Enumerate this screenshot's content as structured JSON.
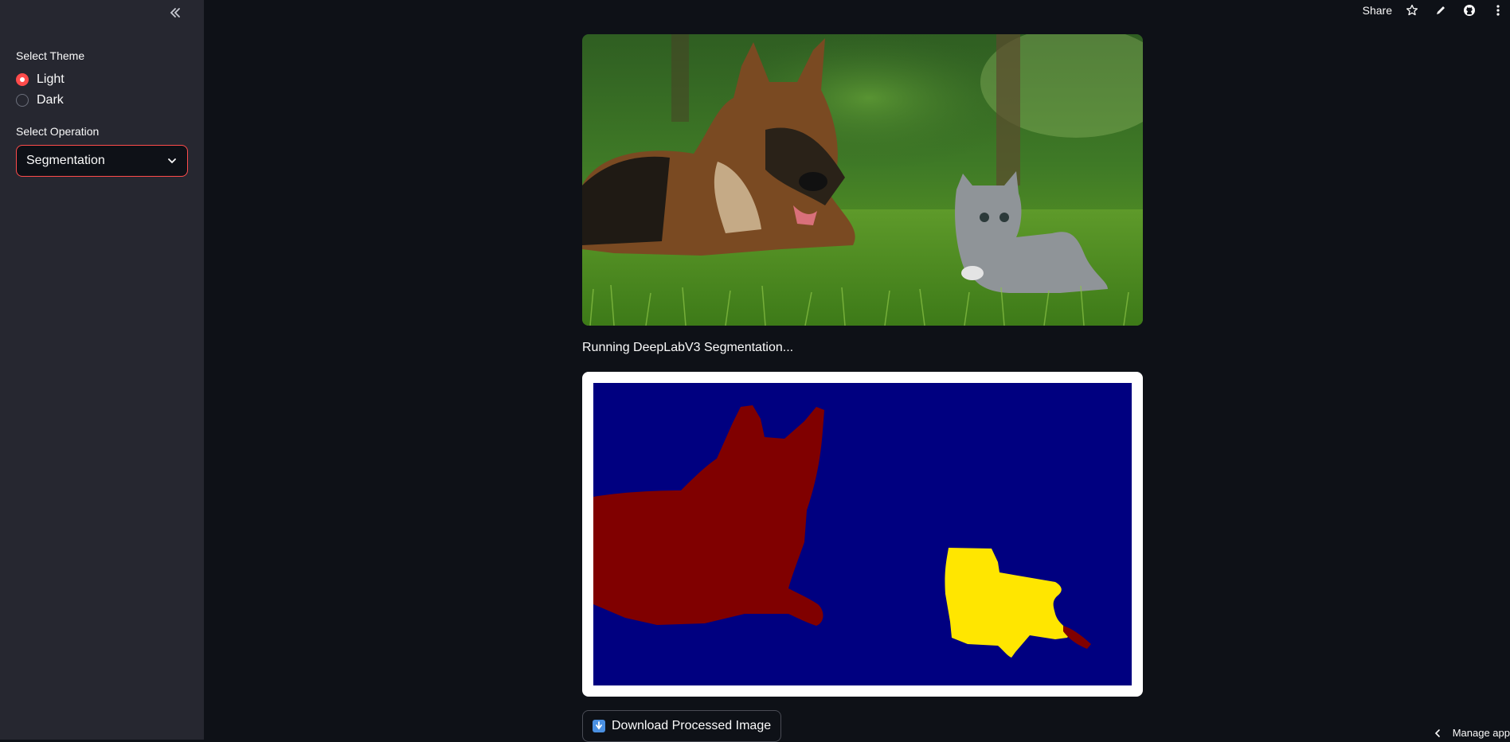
{
  "sidebar": {
    "theme_label": "Select Theme",
    "theme_options": [
      "Light",
      "Dark"
    ],
    "theme_selected": "Light",
    "operation_label": "Select Operation",
    "operation_value": "Segmentation"
  },
  "toolbar": {
    "share_label": "Share",
    "icons": [
      "star-icon",
      "pencil-icon",
      "github-icon",
      "more-vert-icon"
    ]
  },
  "main": {
    "status_text": "Running DeepLabV3 Segmentation...",
    "download_label": "Download Processed Image",
    "manage_label": "Manage app"
  },
  "colors": {
    "accent": "#ff4b4b",
    "background": "#0e1117",
    "sidebar": "#262730",
    "seg_background": "#000080",
    "seg_dog": "#800000",
    "seg_cat": "#ffe600"
  }
}
